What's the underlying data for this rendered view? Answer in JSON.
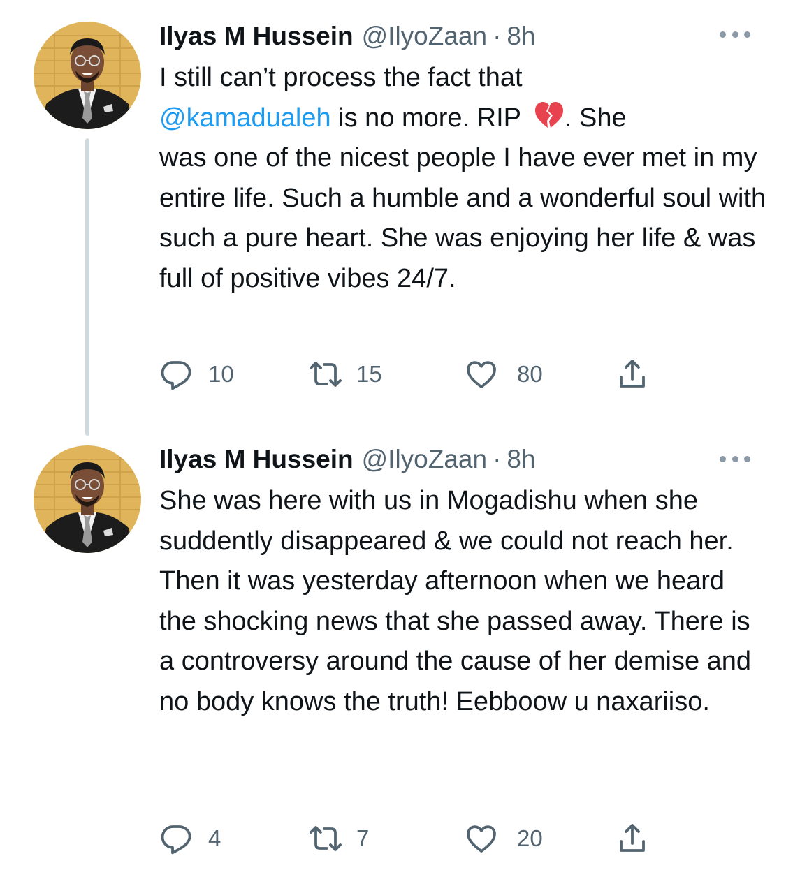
{
  "tweets": [
    {
      "author": {
        "name": "Ilyas M Hussein",
        "handle": "@IlyoZaan",
        "separator": "·",
        "time": "8h"
      },
      "text": {
        "line1": "I still can’t process the fact that",
        "mention": "@kamadualeh",
        "after_mention": " is no more. RIP ",
        "emoji": "broken-heart",
        "after_emoji": ". She",
        "rest": "was one of the nicest people I have ever met in my entire life. Such a humble and a wonderful soul with such a pure heart. She was enjoying her life & was full of positive vibes 24/7."
      },
      "actions": {
        "replies": "10",
        "retweets": "15",
        "likes": "80"
      }
    },
    {
      "author": {
        "name": "Ilyas M Hussein",
        "handle": "@IlyoZaan",
        "separator": "·",
        "time": "8h"
      },
      "text": {
        "body": "She was here with us in Mogadishu when she suddently disappeared & we could not reach her. Then it was yesterday afternoon when we heard the shocking news that she passed away. There is a controversy around the cause of her demise and no body knows the truth! Eebboow u naxariiso."
      },
      "actions": {
        "replies": "4",
        "retweets": "7",
        "likes": "20"
      }
    }
  ],
  "icons": {
    "reply": "reply-icon",
    "retweet": "retweet-icon",
    "like": "like-icon",
    "share": "share-icon",
    "more": "more-icon"
  },
  "colors": {
    "text": "#0f1419",
    "secondary": "#536471",
    "link": "#1d9bf0",
    "thread_line": "#cfd9de",
    "emoji": "#e8424e"
  }
}
